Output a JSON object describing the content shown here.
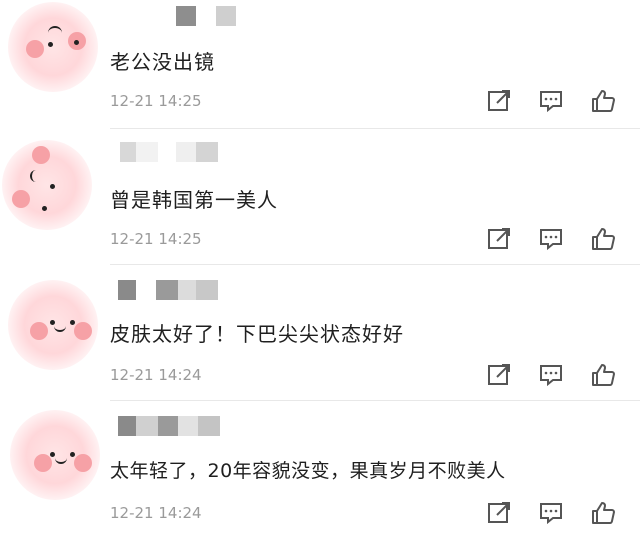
{
  "comments": [
    {
      "text": "老公没出镜",
      "time": "12-21 14:25"
    },
    {
      "text": "曾是韩国第一美人",
      "time": "12-21 14:25"
    },
    {
      "text": "皮肤太好了！下巴尖尖状态好好",
      "time": "12-21 14:24"
    },
    {
      "text": "太年轻了，20年容貌没变，果真岁月不败美人",
      "time": "12-21 14:24"
    }
  ],
  "icons": {
    "share": "share-icon",
    "comment": "comment-icon",
    "like": "like-icon"
  },
  "colors": {
    "text": "#1f1f1f",
    "time": "#9a9a9a",
    "icon": "#555555",
    "divider": "#e8e8e8",
    "avatar_pink": "#ffd7da",
    "cheek": "#f6a1a6"
  }
}
